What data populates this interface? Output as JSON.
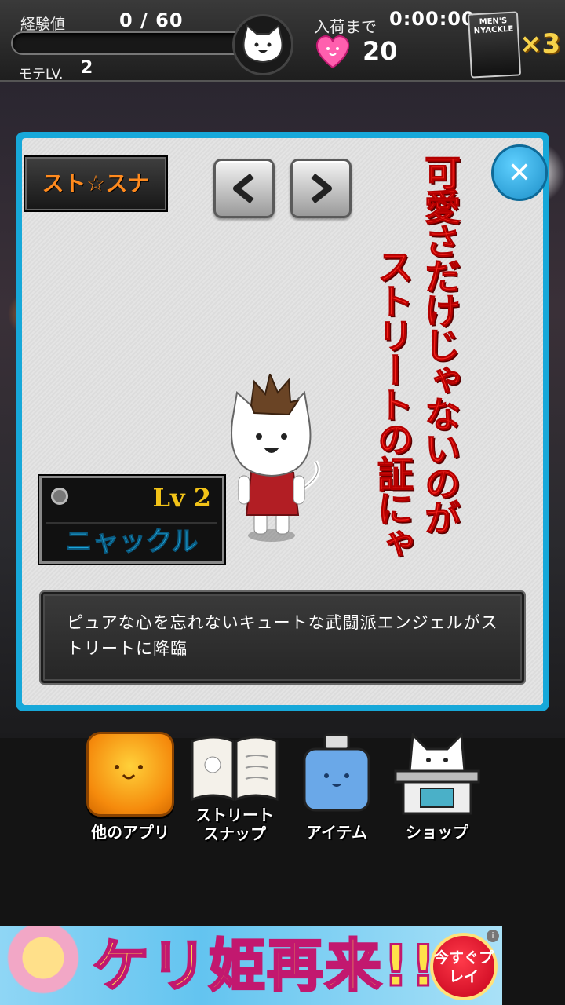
{
  "hud": {
    "exp_label": "経験値",
    "exp_value": "0 / 60",
    "exp_progress": 0,
    "mote_label": "モテLV.",
    "mote_level": "2",
    "restock_label": "入荷まで",
    "restock_time": "0:00:00",
    "hearts": "20",
    "magazine_title": "MEN'S NYACKLE",
    "magazine_count": "×3"
  },
  "panel": {
    "tag": "スト☆スナ",
    "prev_label": "<",
    "next_label": ">",
    "close_label": "✕",
    "catchphrase_line1": "可愛さだけじゃないのが",
    "catchphrase_line2": "ストリートの証にゃ",
    "level": "Lv 2",
    "character_name": "ニャックル",
    "description": "ピュアな心を忘れないキュートな武闘派エンジェルがストリートに降臨"
  },
  "menu": {
    "other_apps": "他のアプリ",
    "street_snap_line1": "ストリート",
    "street_snap_line2": "スナップ",
    "item": "アイテム",
    "shop": "ショップ"
  },
  "banner": {
    "headline": "ケリ姫再来!!",
    "cta": "今すぐプレイ",
    "info": "i"
  },
  "colors": {
    "panel_border": "#17a8d9",
    "catchphrase": "#f5231d",
    "name_plate_text": "#22b0e4",
    "level_text": "#f2c318",
    "tag_text": "#ff8a1e"
  }
}
